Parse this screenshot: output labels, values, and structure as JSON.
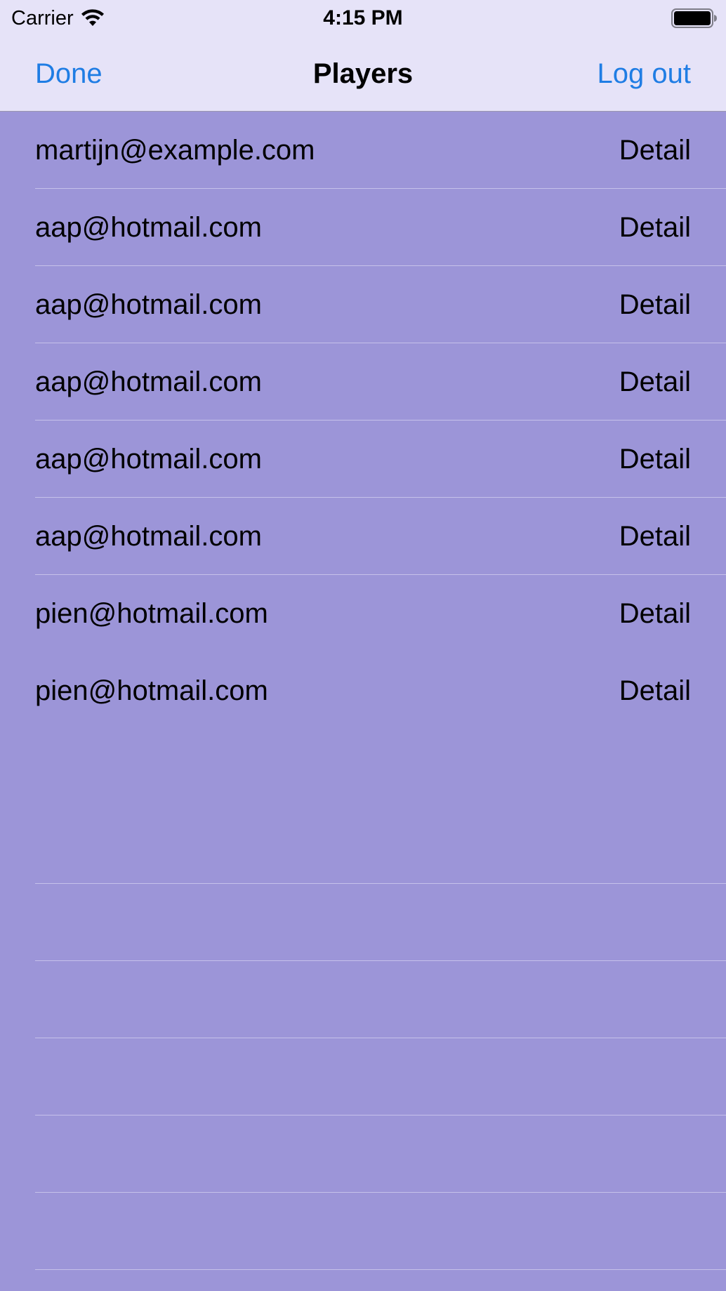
{
  "status_bar": {
    "carrier": "Carrier",
    "time": "4:15 PM",
    "wifi_icon": "wifi-icon",
    "battery_icon": "battery-full-icon"
  },
  "nav": {
    "left_button": "Done",
    "title": "Players",
    "right_button": "Log out",
    "accent_color": "#1f7de4"
  },
  "players": [
    {
      "email": "martijn@example.com",
      "detail": "Detail"
    },
    {
      "email": "aap@hotmail.com",
      "detail": "Detail"
    },
    {
      "email": "aap@hotmail.com",
      "detail": "Detail"
    },
    {
      "email": "aap@hotmail.com",
      "detail": "Detail"
    },
    {
      "email": "aap@hotmail.com",
      "detail": "Detail"
    },
    {
      "email": "aap@hotmail.com",
      "detail": "Detail"
    },
    {
      "email": "pien@hotmail.com",
      "detail": "Detail"
    },
    {
      "email": "pien@hotmail.com",
      "detail": "Detail"
    }
  ],
  "colors": {
    "background": "#9c95d8",
    "bar_background": "#e6e3f8",
    "separator": "#c6c1ea"
  }
}
